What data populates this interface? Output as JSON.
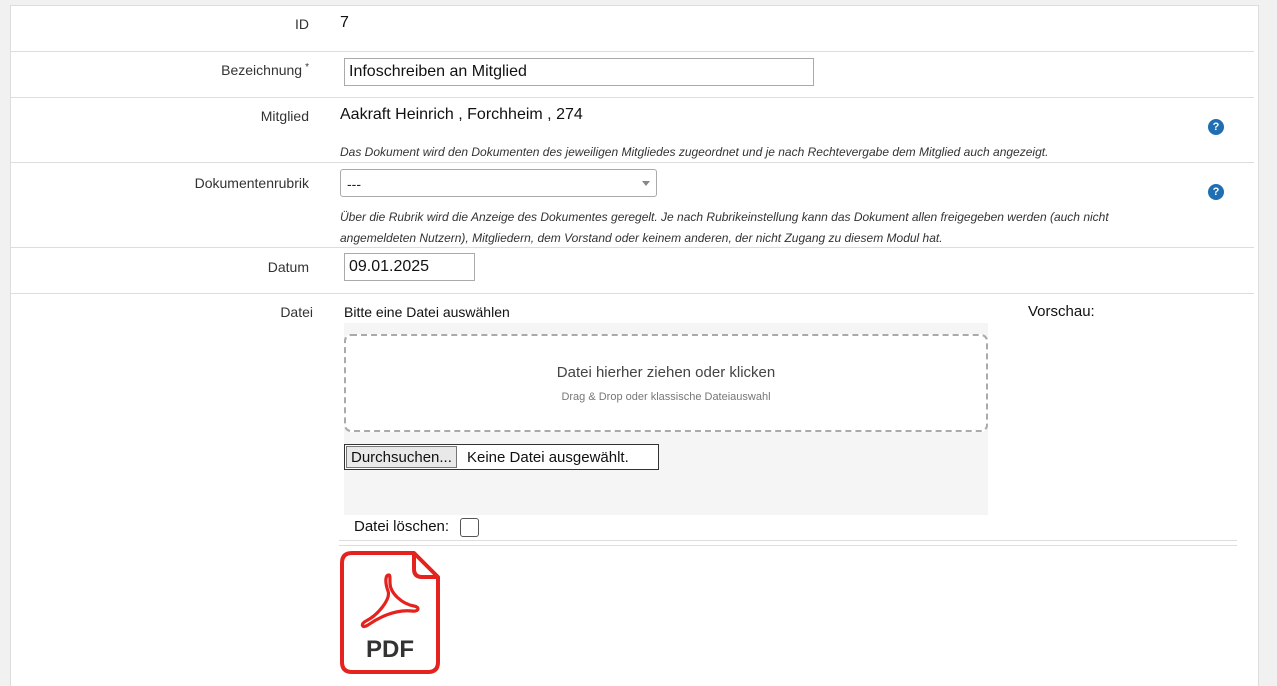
{
  "form": {
    "id": {
      "label": "ID",
      "value": "7"
    },
    "bezeichnung": {
      "label": "Bezeichnung",
      "required_mark": "*",
      "value": "Infoschreiben an Mitglied"
    },
    "mitglied": {
      "label": "Mitglied",
      "value": "Aakraft Heinrich , Forchheim , 274",
      "hint": "Das Dokument wird den Dokumenten des jeweiligen Mitgliedes zugeordnet und je nach Rechtevergabe dem Mitglied auch angezeigt.",
      "help": "?"
    },
    "rubrik": {
      "label": "Dokumentenrubrik",
      "selected": "---",
      "hint_line1": "Über die Rubrik wird die Anzeige des Dokumentes geregelt. Je nach Rubrikeinstellung kann das Dokument allen freigegeben werden (auch nicht",
      "hint_line2": "angemeldeten Nutzern), Mitgliedern, dem Vorstand oder keinem anderen, der nicht Zugang zu diesem Modul hat.",
      "help": "?"
    },
    "datum": {
      "label": "Datum",
      "value": "09.01.2025"
    },
    "datei": {
      "label": "Datei",
      "upload_title": "Bitte eine Datei auswählen",
      "drop_main": "Datei hierher ziehen oder klicken",
      "drop_sub": "Drag & Drop oder klassische Dateiauswahl",
      "browse_label": "Durchsuchen...",
      "no_file": "Keine Datei ausgewählt.",
      "preview_label": "Vorschau:",
      "delete_label": "Datei löschen:",
      "delete_checked": false,
      "file_icon_text": "PDF"
    }
  },
  "colors": {
    "help": "#1f6fb2",
    "pdf_red": "#e4231f"
  }
}
